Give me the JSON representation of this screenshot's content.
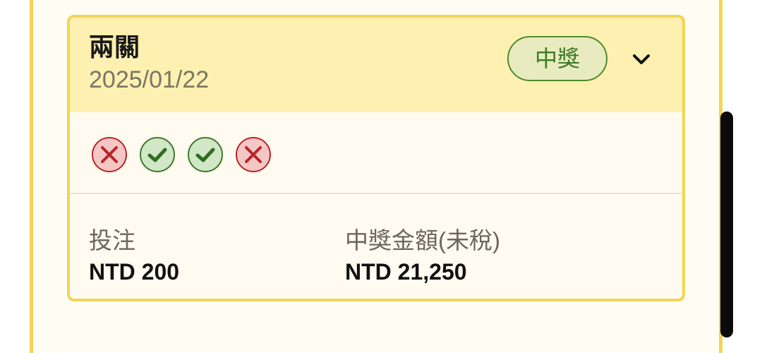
{
  "card": {
    "title": "兩關",
    "date": "2025/01/22",
    "status_badge": "中獎",
    "results": [
      "lose",
      "win",
      "win",
      "lose"
    ],
    "bet_label": "投注",
    "bet_value": "NTD 200",
    "prize_label": "中獎金額(未稅)",
    "prize_value": "NTD 21,250"
  },
  "icons": {
    "expand": "chevron-down-icon",
    "win": "check-circle-icon",
    "lose": "x-circle-icon"
  },
  "colors": {
    "card_border": "#f3d456",
    "header_bg": "#fdf0b0",
    "win_green": "#3d7a26",
    "lose_red": "#b8242a"
  }
}
